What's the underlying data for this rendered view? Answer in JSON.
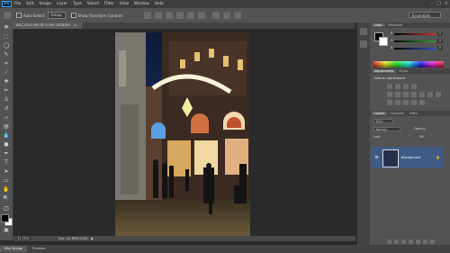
{
  "app": {
    "logo": "Ps",
    "menu": [
      "File",
      "Edit",
      "Image",
      "Layer",
      "Type",
      "Select",
      "Filter",
      "View",
      "Window",
      "Help"
    ],
    "window_controls": [
      "–",
      "□",
      "×"
    ]
  },
  "options_bar": {
    "auto_select_label": "Auto-Select:",
    "auto_select_value": "Group",
    "transform_label": "Show Transform Controls",
    "workspace": "Essentials"
  },
  "document": {
    "tab_title": "DSC_0510.JPG @ 11.8% (RGB/8*)",
    "zoom": "11.79%",
    "doc_info": "Doc: 44.8M/44.8M"
  },
  "bottom_tabs": [
    "Mini Bridge",
    "Timeline"
  ],
  "panels": {
    "color_tabs": [
      "Color",
      "Swatches"
    ],
    "sliders": [
      {
        "label": "R",
        "value": "0",
        "color": "#d03030"
      },
      {
        "label": "G",
        "value": "0",
        "color": "#30a030"
      },
      {
        "label": "B",
        "value": "0",
        "color": "#3050d0"
      }
    ],
    "adjust_tabs": [
      "Adjustments",
      "Styles"
    ],
    "adjust_title": "Add an adjustment",
    "layers_tabs": [
      "Layers",
      "Channels",
      "Paths"
    ],
    "kind_label": "Kind",
    "blend_mode": "Normal",
    "opacity_label": "Opacity:",
    "lock_label": "Lock:",
    "fill_label": "Fill:",
    "layer_name": "Background"
  },
  "colors": {
    "foreground": "#000000",
    "background": "#ffffff"
  }
}
